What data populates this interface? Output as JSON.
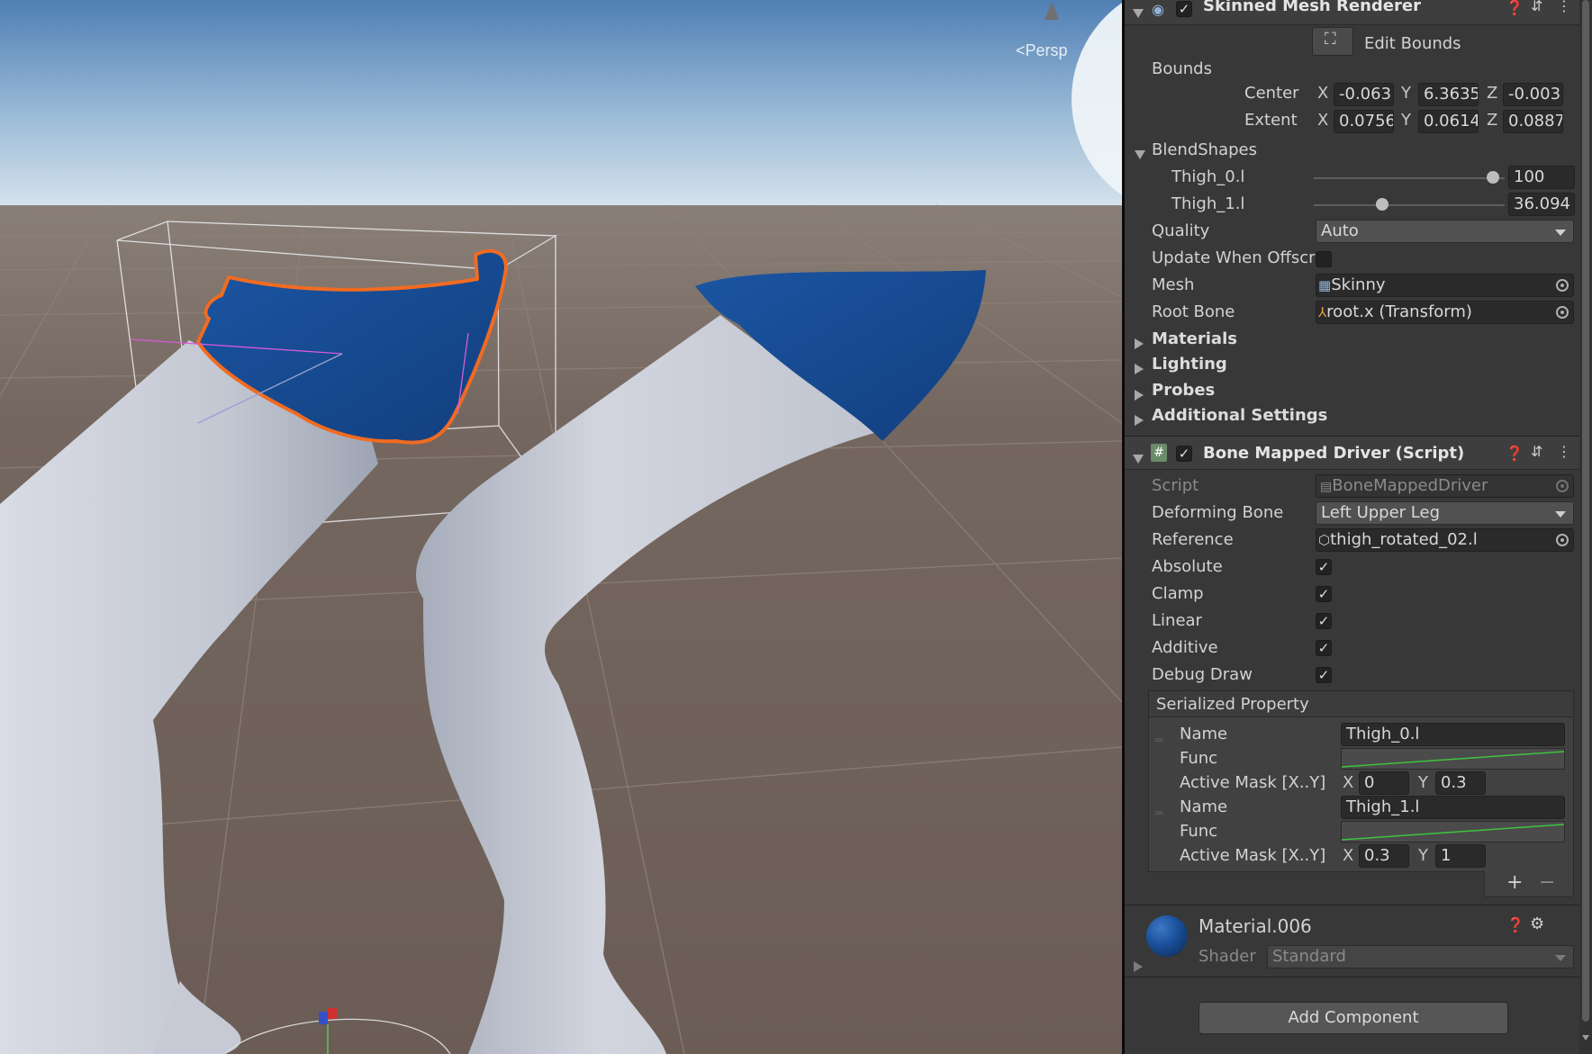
{
  "viewport": {
    "persp_label": "<Persp",
    "colors": {
      "sky_top": "#4f7fb4",
      "sky_horizon": "#d9e5ee",
      "ground": "#6d6058",
      "cloth": "#1a4f9a",
      "outline": "#f26b21",
      "leg": "#c9ccd6"
    }
  },
  "skinned_mesh_renderer": {
    "title": "Skinned Mesh Renderer",
    "edit_bounds_label": "Edit Bounds",
    "bounds_label": "Bounds",
    "center_label": "Center",
    "extent_label": "Extent",
    "center": {
      "x": "-0.063",
      "y": "6.3635",
      "z": "-0.003"
    },
    "extent": {
      "x": "0.0756",
      "y": "0.0614",
      "z": "0.0887"
    },
    "blendshapes_label": "BlendShapes",
    "blendshapes": [
      {
        "name": "Thigh_0.l",
        "value": "100",
        "fraction": 1.0
      },
      {
        "name": "Thigh_1.l",
        "value": "36.094",
        "fraction": 0.36094
      }
    ],
    "quality_label": "Quality",
    "quality_value": "Auto",
    "update_offscreen_label": "Update When Offscr",
    "mesh_label": "Mesh",
    "mesh_value": "Skinny",
    "root_bone_label": "Root Bone",
    "root_bone_value": "root.x (Transform)",
    "foldouts": [
      "Materials",
      "Lighting",
      "Probes",
      "Additional Settings"
    ]
  },
  "bone_mapped_driver": {
    "title": "Bone Mapped Driver (Script)",
    "script_label": "Script",
    "script_value": "BoneMappedDriver",
    "deforming_bone_label": "Deforming Bone",
    "deforming_bone_value": "Left Upper Leg",
    "reference_label": "Reference",
    "reference_value": "thigh_rotated_02.l",
    "toggles": [
      {
        "label": "Absolute",
        "checked": true
      },
      {
        "label": "Clamp",
        "checked": true
      },
      {
        "label": "Linear",
        "checked": true
      },
      {
        "label": "Additive",
        "checked": true
      },
      {
        "label": "Debug Draw",
        "checked": true
      }
    ],
    "serialized_property_label": "Serialized Property",
    "items": [
      {
        "name_label": "Name",
        "name_value": "Thigh_0.l",
        "func_label": "Func",
        "mask_label": "Active Mask [X..Y]",
        "mask_x": "0",
        "mask_y": "0.3"
      },
      {
        "name_label": "Name",
        "name_value": "Thigh_1.l",
        "func_label": "Func",
        "mask_label": "Active Mask [X..Y]",
        "mask_x": "0.3",
        "mask_y": "1"
      }
    ],
    "add_symbol": "+",
    "remove_symbol": "−"
  },
  "material": {
    "name": "Material.006",
    "shader_label": "Shader",
    "shader_value": "Standard"
  },
  "add_component_label": "Add Component",
  "axis_labels": {
    "x": "X",
    "y": "Y",
    "z": "Z"
  },
  "icons": [
    "eye-icon",
    "help-icon",
    "preset-icon",
    "kebab-menu-icon",
    "edit-bounds-icon",
    "mesh-grid-icon",
    "transform-icon",
    "script-icon",
    "gameobject-icon",
    "object-picker-icon",
    "gear-icon",
    "material-sphere-icon"
  ]
}
